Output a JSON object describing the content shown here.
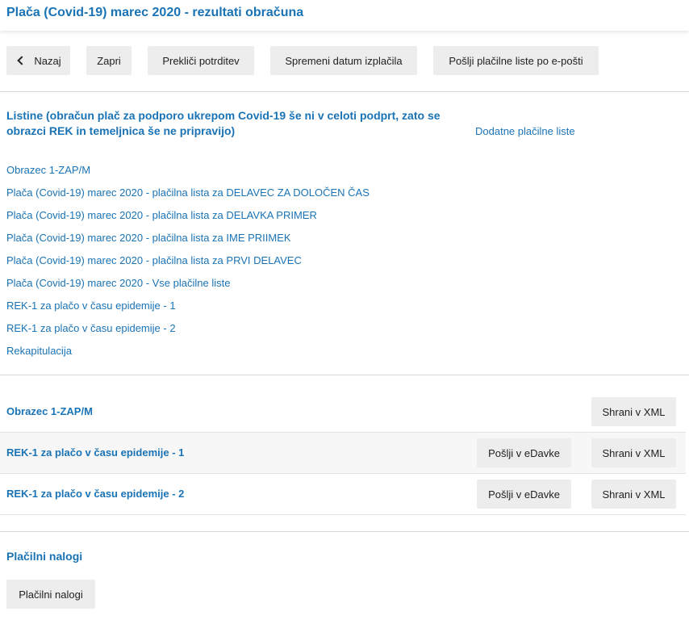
{
  "header": {
    "title": "Plača (Covid-19) marec 2020 - rezultati obračuna"
  },
  "toolbar": {
    "back_label": "Nazaj",
    "close_label": "Zapri",
    "cancel_confirm_label": "Prekliči potrditev",
    "change_date_label": "Spremeni datum izplačila",
    "send_email_label": "Pošlji plačilne liste po e-pošti"
  },
  "listine": {
    "heading_line1": "Listine (obračun plač za podporo ukrepom Covid-19 še ni v celoti podprt, zato se",
    "heading_line2": "obrazci REK in temeljnica še ne pripravijo)",
    "extra_link": "Dodatne plačilne liste",
    "links": [
      "Obrazec 1-ZAP/M",
      "Plača (Covid-19) marec 2020 - plačilna lista za DELAVEC ZA DOLOČEN ČAS",
      "Plača (Covid-19) marec 2020 - plačilna lista za DELAVKA PRIMER",
      "Plača (Covid-19) marec 2020 - plačilna lista za IME PRIIMEK",
      "Plača (Covid-19) marec 2020 - plačilna lista za PRVI DELAVEC",
      "Plača (Covid-19) marec 2020 - Vse plačilne liste",
      "REK-1 za plačo v času epidemije - 1",
      "REK-1 za plačo v času epidemije - 2",
      "Rekapitulacija"
    ]
  },
  "forms": {
    "rows": [
      {
        "name": "Obrazec 1-ZAP/M",
        "save_label": "Shrani v XML"
      },
      {
        "name": "REK-1 za plačo v času epidemije - 1",
        "send_label": "Pošlji v eDavke",
        "save_label": "Shrani v XML"
      },
      {
        "name": "REK-1 za plačo v času epidemije - 2",
        "send_label": "Pošlji v eDavke",
        "save_label": "Shrani v XML"
      }
    ]
  },
  "payments": {
    "heading": "Plačilni nalogi",
    "button_label": "Plačilni nalogi"
  }
}
